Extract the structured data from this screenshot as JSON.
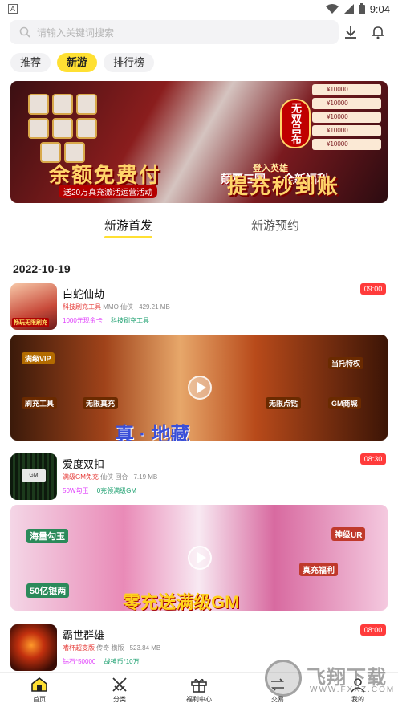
{
  "status_bar": {
    "time": "9:04",
    "left_badge": "A"
  },
  "search": {
    "placeholder": "请输入关键词搜索"
  },
  "top_tabs": [
    {
      "label": "推荐",
      "active": false
    },
    {
      "label": "新游",
      "active": true
    },
    {
      "label": "排行榜",
      "active": false
    }
  ],
  "banner": {
    "headline_left": "余额免费付",
    "headline_right": "提充秒到账",
    "subline": "送20万真充激活运营活动",
    "seal": "无双吕布",
    "mid_a": "颠覆三国",
    "mid_b": "登入英雄",
    "mid_c": "全新福利"
  },
  "sub_tabs": [
    {
      "label": "新游首发",
      "active": true
    },
    {
      "label": "新游预约",
      "active": false
    }
  ],
  "date_label": "2022-10-19",
  "games": [
    {
      "name": "白蛇仙劫",
      "meta_highlight": "科技刷充工具",
      "meta": "MMO 仙侠 · 429.21 MB",
      "tags": [
        {
          "text": "1000元现金卡",
          "color": "#e040fb"
        },
        {
          "text": "科技刷充工具",
          "color": "#1a9f6e"
        }
      ],
      "time": "09:00",
      "icon_label": "畅玩无限刷充"
    },
    {
      "name": "爱度双扣",
      "meta_highlight": "满级GM免充",
      "meta": "仙侠 回合 · 7.19 MB",
      "tags": [
        {
          "text": "50W勾玉",
          "color": "#e040fb"
        },
        {
          "text": "0充领满级GM",
          "color": "#1a9f6e"
        }
      ],
      "time": "08:30",
      "icon_label": "GM"
    },
    {
      "name": "霸世群雄",
      "meta_highlight": "嗜杯超变版",
      "meta": "传奇 横版 · 523.84 MB",
      "tags": [
        {
          "text": "钻石*50000",
          "color": "#e040fb"
        },
        {
          "text": "战神币*10万",
          "color": "#1a9f6e"
        }
      ],
      "time": "08:00",
      "icon_label": ""
    }
  ],
  "videos": [
    {
      "labels": [
        "满级VIP",
        "刷充工具",
        "无限真充",
        "无限点钻",
        "GM商城",
        "当托特权"
      ],
      "caption": "真 · 地藏"
    },
    {
      "labels": [
        "海量勾玉",
        "50亿银两",
        "真充福利",
        "神级UR"
      ],
      "caption": "零充送满级GM"
    }
  ],
  "nav": [
    {
      "label": "首页",
      "icon": "home-icon"
    },
    {
      "label": "分类",
      "icon": "swords-icon"
    },
    {
      "label": "福利中心",
      "icon": "gift-icon"
    },
    {
      "label": "交易",
      "icon": "trade-icon"
    },
    {
      "label": "我的",
      "icon": "user-icon"
    }
  ],
  "watermark": {
    "text": "飞翔下载",
    "url": "WWW.FXXZ.COM"
  }
}
